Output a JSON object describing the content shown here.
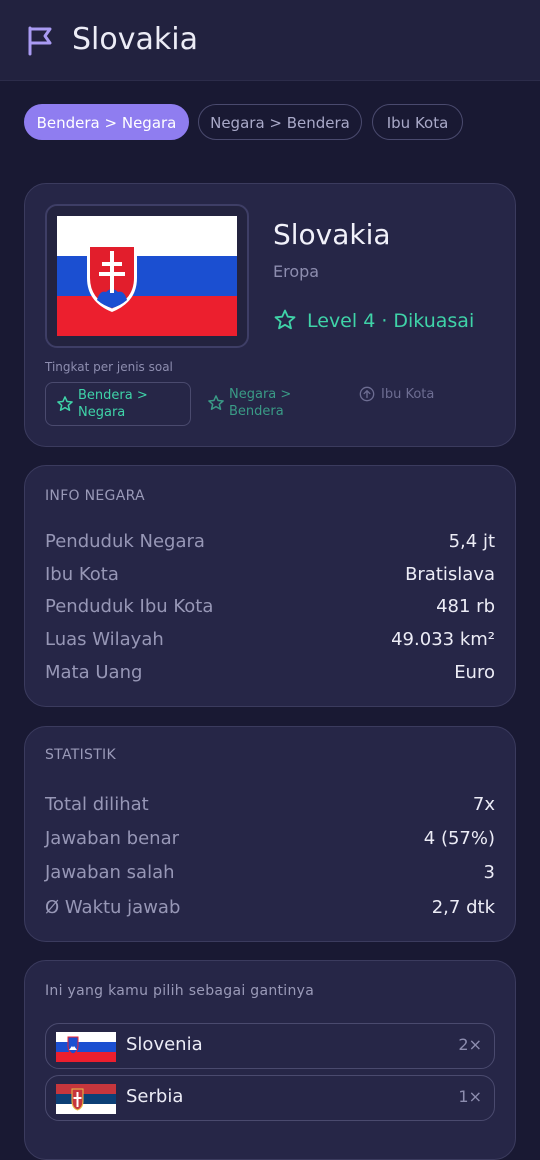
{
  "header": {
    "title": "Slovakia",
    "icon": "flag-icon"
  },
  "tabs": [
    {
      "label": "Bendera > Negara",
      "active": true
    },
    {
      "label": "Negara > Bendera",
      "active": false
    },
    {
      "label": "Ibu Kota",
      "active": false
    }
  ],
  "country": {
    "name": "Slovakia",
    "continent": "Eropa",
    "level": "Level 4 · Dikuasai",
    "level_color": "#3fd3a8",
    "level_by_type_label": "Tingkat per jenis soal",
    "type_levels": [
      {
        "label": "Bendera > Negara",
        "icon": "star-icon",
        "state": "active"
      },
      {
        "label": "Negara > Bendera",
        "icon": "star-icon",
        "state": "dim"
      },
      {
        "label": "Ibu Kota",
        "icon": "arrow-up-circle-icon",
        "state": "muted"
      }
    ]
  },
  "info": {
    "title": "INFO NEGARA",
    "rows": [
      {
        "label": "Penduduk Negara",
        "value": "5,4 jt"
      },
      {
        "label": "Ibu Kota",
        "value": "Bratislava"
      },
      {
        "label": "Penduduk Ibu Kota",
        "value": "481 rb"
      },
      {
        "label": "Luas Wilayah",
        "value": "49.033 km²"
      },
      {
        "label": "Mata Uang",
        "value": "Euro"
      }
    ]
  },
  "stats": {
    "title": "STATISTIK",
    "rows": [
      {
        "label": "Total dilihat",
        "value": "7x"
      },
      {
        "label": "Jawaban benar",
        "value": "4 (57%)"
      },
      {
        "label": "Jawaban salah",
        "value": "3"
      },
      {
        "label": "Ø Waktu jawab",
        "value": "2,7 dtk"
      }
    ]
  },
  "alternatives": {
    "title": "Ini yang kamu pilih sebagai gantinya",
    "items": [
      {
        "name": "Slovenia",
        "count": "2×"
      },
      {
        "name": "Serbia",
        "count": "1×"
      }
    ]
  },
  "colors": {
    "accent": "#8f7df0",
    "background": "#191933",
    "card": "#262647",
    "mastered": "#3fd3a8"
  }
}
